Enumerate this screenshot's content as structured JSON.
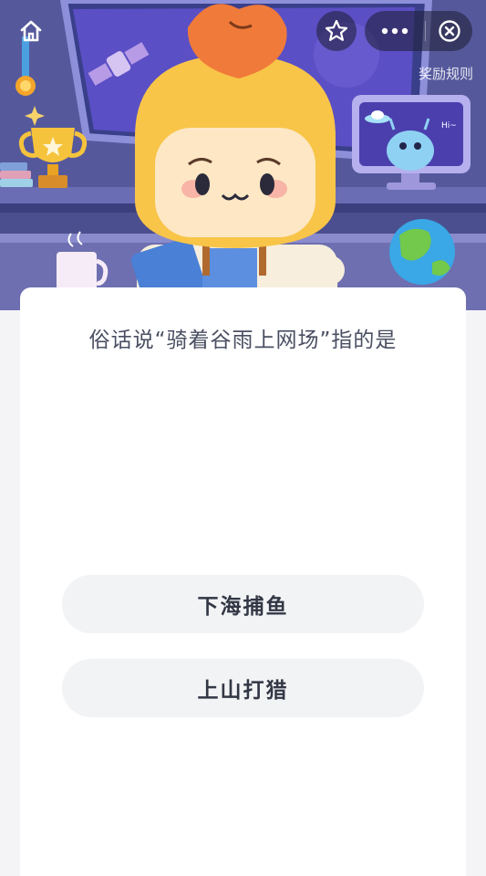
{
  "header": {
    "rules_label": "奖励规则"
  },
  "quiz": {
    "question": "俗话说“骑着谷雨上网场”指的是",
    "options": [
      {
        "label": "下海捕鱼"
      },
      {
        "label": "上山打猎"
      }
    ]
  },
  "illustration": {
    "monitor_greeting": "Hi~"
  },
  "icons": {
    "home": "home-icon",
    "star": "star-icon",
    "more": "more-dots-icon",
    "close": "close-circle-icon"
  }
}
